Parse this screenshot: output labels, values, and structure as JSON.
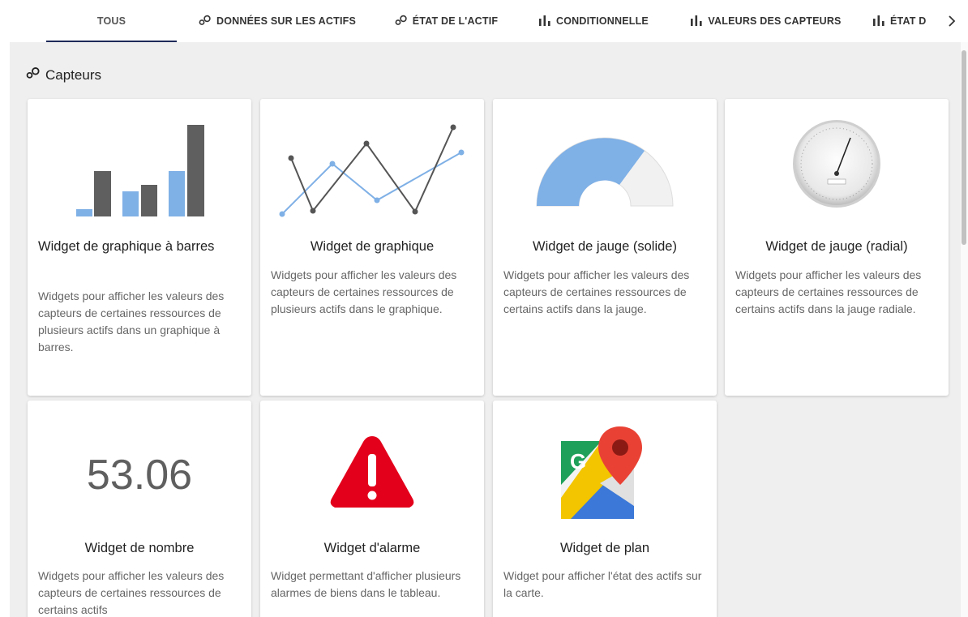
{
  "tabs": [
    {
      "label": "TOUS",
      "icon": "none",
      "active": true
    },
    {
      "label": "DONNÉES SUR LES ACTIFS",
      "icon": "circles-icon"
    },
    {
      "label": "ÉTAT DE L'ACTIF",
      "icon": "circles-icon"
    },
    {
      "label": "CONDITIONNELLE",
      "icon": "bar-chart-icon"
    },
    {
      "label": "VALEURS DES CAPTEURS",
      "icon": "bar-chart-icon"
    },
    {
      "label": "ÉTAT D",
      "icon": "bar-chart-icon"
    }
  ],
  "section": {
    "title": "Capteurs",
    "icon": "circles-icon"
  },
  "cards": [
    {
      "title": "Widget de graphique à barres",
      "desc": "Widgets pour afficher les valeurs des capteurs de certaines ressources de plusieurs actifs dans un graphique à barres.",
      "icon": "bar-chart-preview"
    },
    {
      "title": "Widget de graphique",
      "desc": "Widgets pour afficher les valeurs des capteurs de certaines ressources de plusieurs actifs dans le graphique.",
      "icon": "line-chart-preview"
    },
    {
      "title": "Widget de jauge (solide)",
      "desc": "Widgets pour afficher les valeurs des capteurs de certaines ressources de certains actifs dans la jauge.",
      "icon": "solid-gauge-preview"
    },
    {
      "title": "Widget de jauge (radial)",
      "desc": "Widgets pour afficher les valeurs des capteurs de certaines ressources de certains actifs dans la jauge radiale.",
      "icon": "radial-gauge-preview"
    },
    {
      "title": "Widget de nombre",
      "desc": "Widgets pour afficher les valeurs des capteurs de certaines ressources de certains actifs",
      "icon": "number-preview",
      "number": "53.06"
    },
    {
      "title": "Widget d'alarme",
      "desc": "Widget permettant d'afficher plusieurs alarmes de biens dans le tableau.",
      "icon": "alarm-icon"
    },
    {
      "title": "Widget de plan",
      "desc": "Widget pour afficher l'état des actifs sur la carte.",
      "icon": "map-icon"
    }
  ],
  "colors": {
    "accent": "#1e2a5a",
    "bar_dark": "#5f5f5f",
    "bar_light": "#7fb0e6",
    "alarm_red": "#e3001b",
    "panel_bg": "#efefef"
  }
}
